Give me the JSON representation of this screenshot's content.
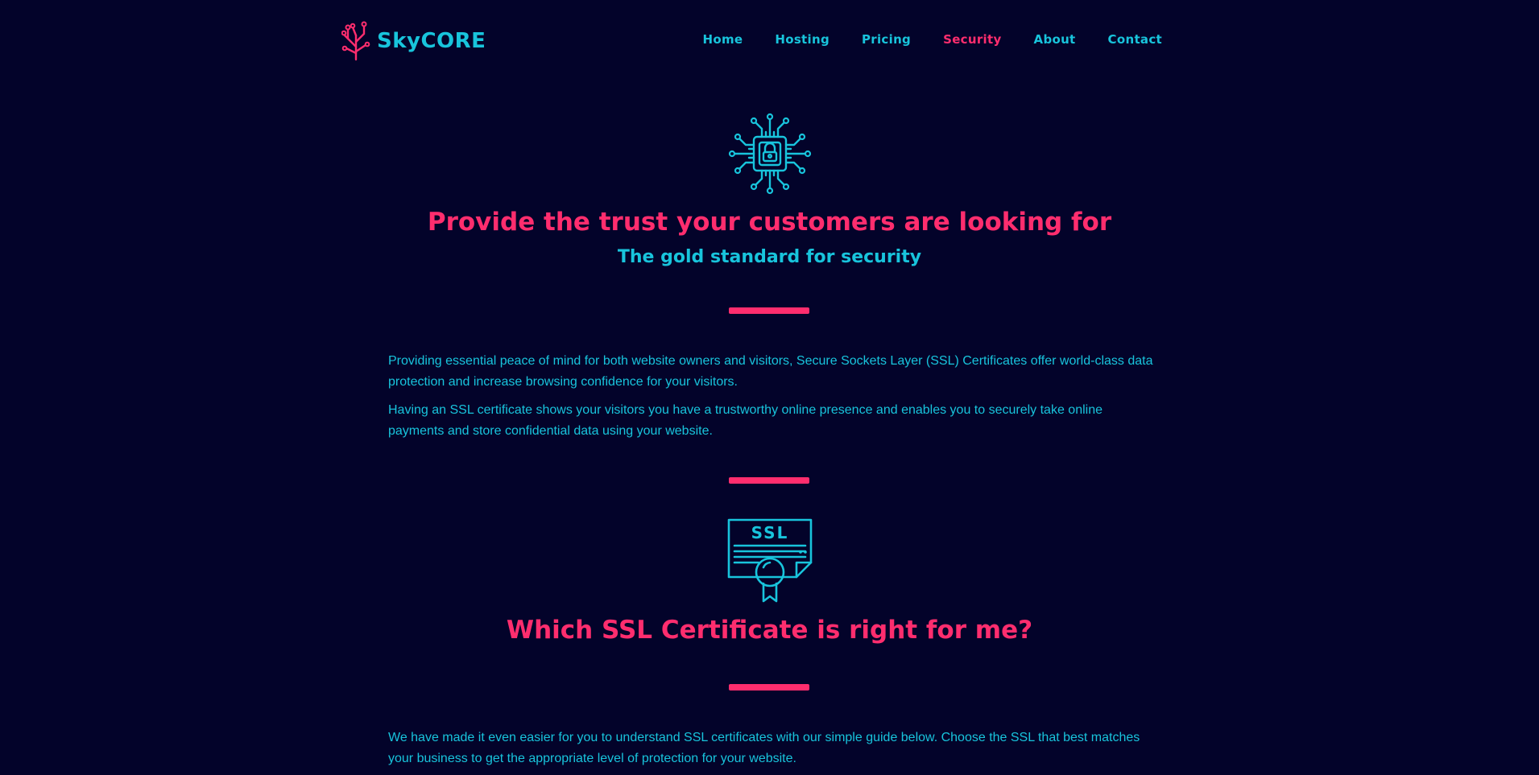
{
  "header": {
    "logo": {
      "text_sky": "Sky",
      "text_core": "CORE",
      "icon": "circuit-tree-icon"
    },
    "nav": [
      {
        "label": "Home",
        "active": false
      },
      {
        "label": "Hosting",
        "active": false
      },
      {
        "label": "Pricing",
        "active": false
      },
      {
        "label": "Security",
        "active": true
      },
      {
        "label": "About",
        "active": false
      },
      {
        "label": "Contact",
        "active": false
      }
    ]
  },
  "hero": {
    "icon": "circuit-lock-icon",
    "title": "Provide the trust your customers are looking for",
    "subtitle": "The gold standard for security",
    "paragraphs": [
      "Providing essential peace of mind for both website owners and visitors, Secure Sockets Layer (SSL) Certificates offer world-class data protection and increase browsing confidence for your visitors.",
      "Having an SSL certificate shows your visitors you have a trustworthy online presence and enables you to securely take online payments and store confidential data using your website."
    ]
  },
  "ssl_section": {
    "icon": "ssl-certificate-icon",
    "icon_text": "SSL",
    "title": "Which SSL Certificate is right for me?",
    "paragraph": "We have made it even easier for you to understand SSL certificates with our simple guide below. Choose the SSL that best matches your business to get the appropriate level of protection for your website."
  },
  "colors": {
    "background": "#03032a",
    "accent_pink": "#ff2d6e",
    "accent_cyan": "#18c4dc"
  }
}
